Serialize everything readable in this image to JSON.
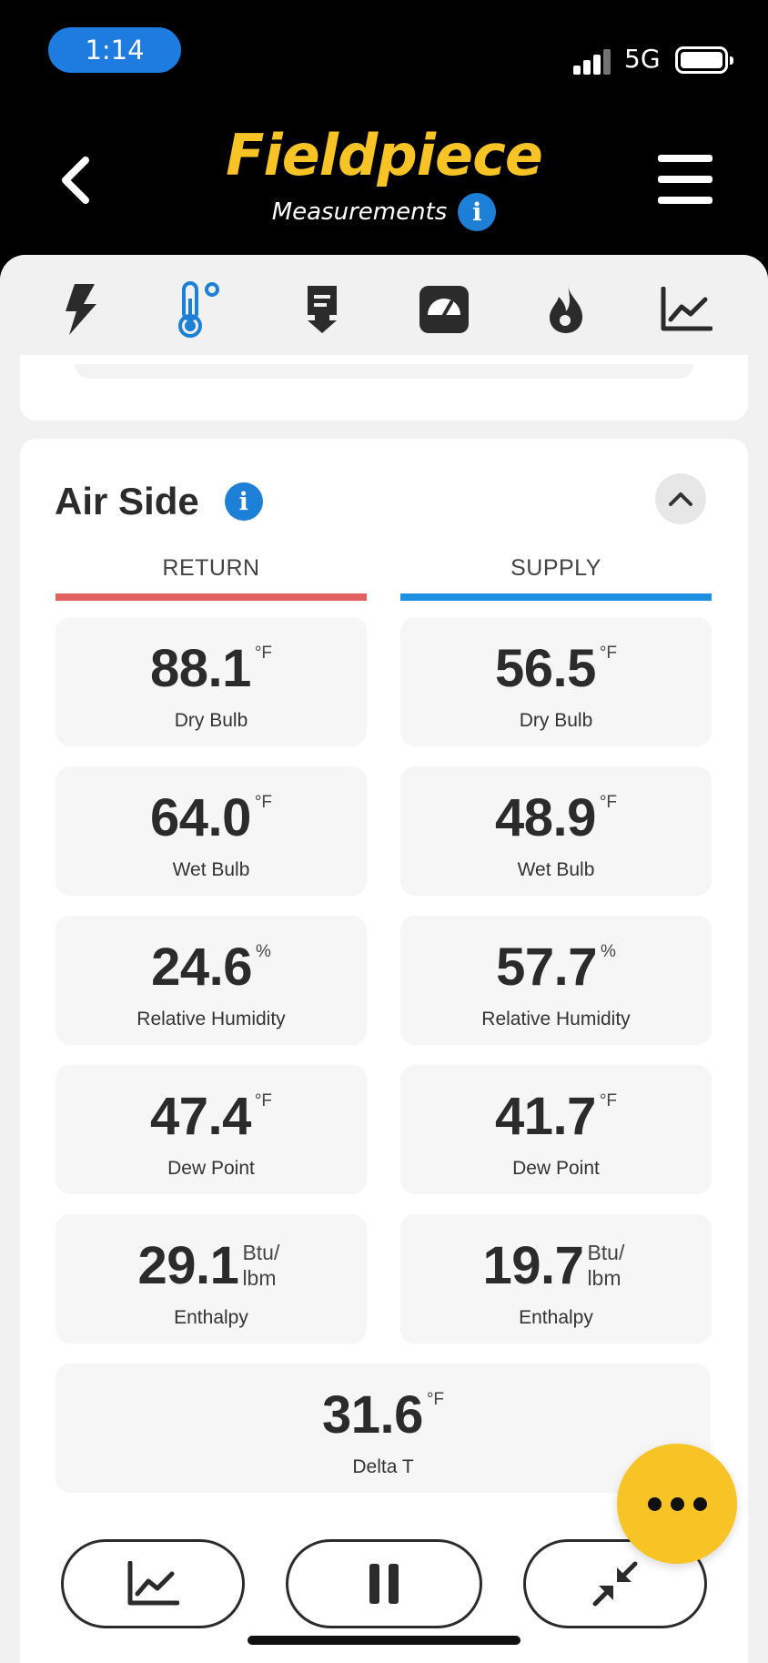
{
  "status_bar": {
    "time": "1:14",
    "network": "5G"
  },
  "header": {
    "brand": "Fieldpiece",
    "subtitle": "Measurements",
    "info_glyph": "i",
    "icons": {
      "back": "chevron-left-icon",
      "menu": "hamburger-menu-icon",
      "info": "info-icon"
    }
  },
  "tabs": [
    {
      "icon": "lightning-icon",
      "active": false
    },
    {
      "icon": "thermometer-icon",
      "active": true
    },
    {
      "icon": "download-tag-icon",
      "active": false
    },
    {
      "icon": "gauge-icon",
      "active": false
    },
    {
      "icon": "flame-icon",
      "active": false
    },
    {
      "icon": "trend-chart-icon",
      "active": false
    }
  ],
  "air_side": {
    "title": "Air Side",
    "info_glyph": "i",
    "return_label": "RETURN",
    "supply_label": "SUPPLY",
    "return_color": "#e06161",
    "supply_color": "#1b8fdd",
    "return": [
      {
        "value": "88.1",
        "unit": "°F",
        "label": "Dry Bulb"
      },
      {
        "value": "64.0",
        "unit": "°F",
        "label": "Wet Bulb"
      },
      {
        "value": "24.6",
        "unit": "%",
        "label": "Relative Humidity"
      },
      {
        "value": "47.4",
        "unit": "°F",
        "label": "Dew Point"
      },
      {
        "value": "29.1",
        "unit": "Btu/ lbm",
        "label": "Enthalpy"
      }
    ],
    "supply": [
      {
        "value": "56.5",
        "unit": "°F",
        "label": "Dry Bulb"
      },
      {
        "value": "48.9",
        "unit": "°F",
        "label": "Wet Bulb"
      },
      {
        "value": "57.7",
        "unit": "%",
        "label": "Relative Humidity"
      },
      {
        "value": "41.7",
        "unit": "°F",
        "label": "Dew Point"
      },
      {
        "value": "19.7",
        "unit": "Btu/ lbm",
        "label": "Enthalpy"
      }
    ],
    "delta_t": {
      "value": "31.6",
      "unit": "°F",
      "label": "Delta T"
    }
  },
  "bottom_actions": [
    {
      "icon": "trend-chart-icon"
    },
    {
      "icon": "pause-icon"
    },
    {
      "icon": "collapse-arrows-icon"
    }
  ],
  "fab": {
    "icon": "more-dots-icon"
  },
  "colors": {
    "brand_yellow": "#f7c325",
    "accent_blue": "#1d80d6",
    "header_bg": "#000000"
  }
}
